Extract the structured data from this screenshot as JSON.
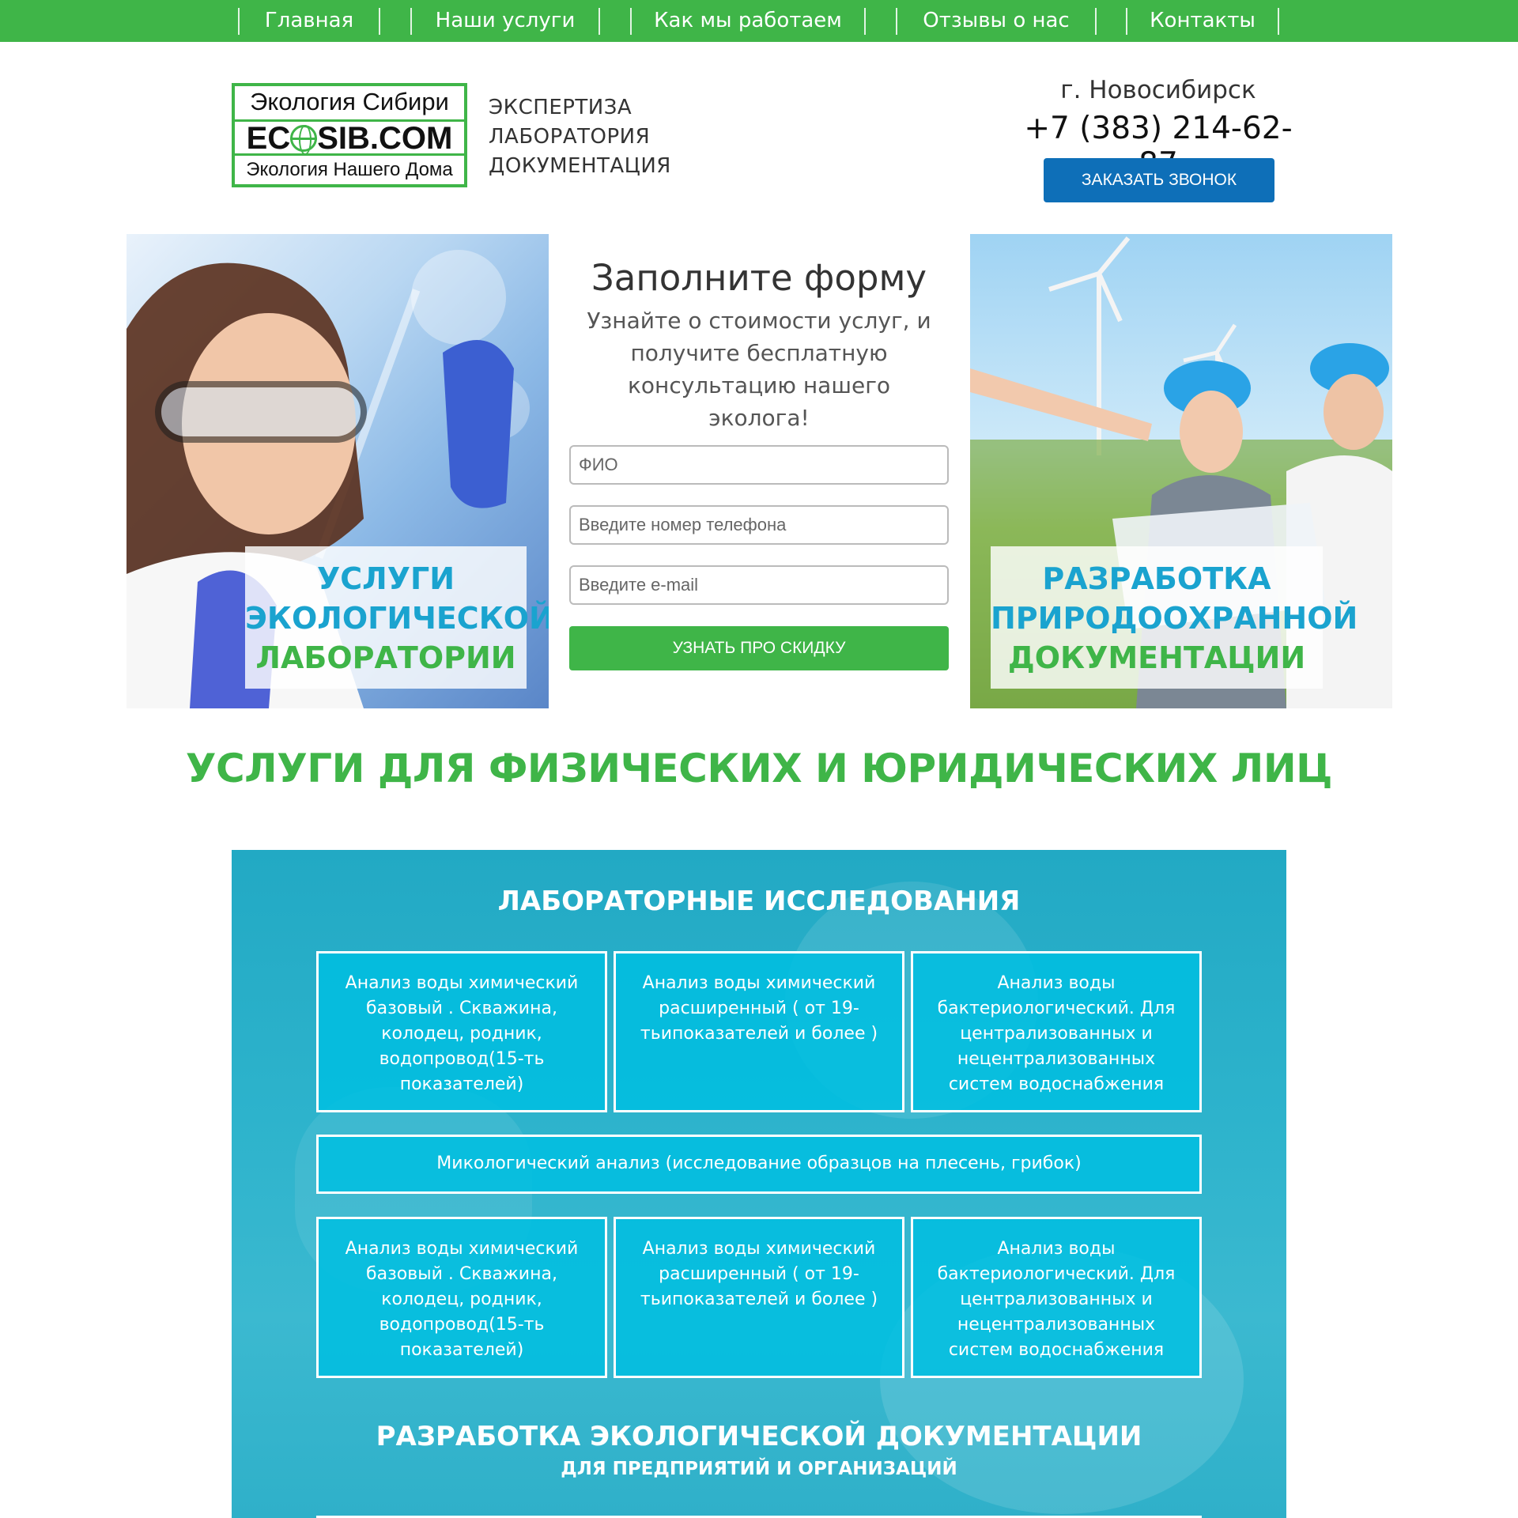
{
  "nav": {
    "items": [
      {
        "label": "Главная"
      },
      {
        "label": "Наши услуги"
      },
      {
        "label": "Как мы работаем"
      },
      {
        "label": "Отзывы о нас"
      },
      {
        "label": "Контакты"
      }
    ]
  },
  "logo": {
    "top": "Экология Сибири",
    "mid_left": "EC",
    "mid_right": "SIB.COM",
    "bottom": "Экология Нашего Дома"
  },
  "tagline": [
    "ЭКСПЕРТИЗА",
    "ЛАБОРАТОРИЯ",
    "ДОКУМЕНТАЦИЯ"
  ],
  "contact": {
    "city": "г. Новосибирск",
    "phone": "+7 (383) 214-62-87",
    "callback_label": "ЗАКАЗАТЬ ЗВОНОК"
  },
  "hero_left": {
    "caption": [
      "УСЛУГИ",
      "ЭКОЛОГИЧЕСКОЙ",
      "ЛАБОРАТОРИИ"
    ]
  },
  "hero_right": {
    "caption": [
      "РАЗРАБОТКА",
      "ПРИРОДООХРАННОЙ",
      "ДОКУМЕНТАЦИИ"
    ]
  },
  "form": {
    "title": "Заполните форму",
    "subtitle": "Узнайте о стоимости услуг, и получите бесплатную консультацию нашего эколога!",
    "name_placeholder": "ФИО",
    "phone_placeholder": "Введите номер телефона",
    "email_placeholder": "Введите e-mail",
    "submit_label": "УЗНАТЬ ПРО СКИДКУ"
  },
  "section_title": "УСЛУГИ ДЛЯ ФИЗИЧЕСКИХ И ЮРИДИЧЕСКИХ ЛИЦ",
  "services": {
    "heading": "ЛАБОРАТОРНЫЕ ИССЛЕДОВАНИЯ",
    "row1": [
      "Анализ воды химический базовый . Скважина, колодец, родник, водопровод(15-ть показателей)",
      "Анализ воды химический расширенный ( от 19-тьипоказателей и более )",
      "Анализ воды бактериологический. Для централизованных и нецентрализованных систем водоснабжения"
    ],
    "wide": "Микологический анализ (исследование образцов на плесень, грибок)",
    "row2": [
      "Анализ воды химический базовый . Скважина, колодец, родник, водопровод(15-ть показателей)",
      "Анализ воды химический расширенный ( от 19-тьипоказателей и более )",
      "Анализ воды бактериологический. Для централизованных и нецентрализованных систем водоснабжения"
    ],
    "heading2": "РАЗРАБОТКА ЭКОЛОГИЧЕСКОЙ ДОКУМЕНТАЦИИ",
    "sub2": "ДЛЯ ПРЕДПРИЯТИЙ И ОРГАНИЗАЦИЙ"
  },
  "colors": {
    "green": "#3fb548",
    "blue_button": "#0e6fb8",
    "caption_blue": "#1aa3cf",
    "services_bg": "#2db3cc"
  }
}
